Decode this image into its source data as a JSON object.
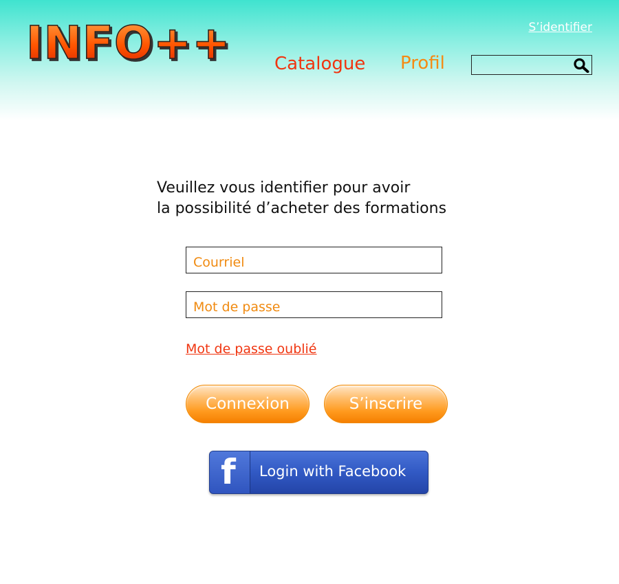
{
  "header": {
    "logo_text": "INFO++",
    "signin_link": "S’identifier",
    "nav": {
      "catalogue": "Catalogue",
      "profil": "Profil"
    },
    "search": {
      "placeholder": "",
      "icon": "search-icon"
    }
  },
  "login": {
    "intro_line1": "Veuillez vous identifier pour avoir",
    "intro_line2": "la possibilité d’acheter des formations",
    "email_placeholder": "Courriel",
    "password_placeholder": "Mot de passe",
    "forgot_link": "Mot de passe oublié",
    "connexion_label": "Connexion",
    "inscrire_label": "S’inscrire",
    "facebook_label": "Login with Facebook",
    "facebook_icon_letter": "f"
  },
  "colors": {
    "header_gradient_top": "#3fe3cf",
    "nav_catalogue": "#f03510",
    "nav_profil": "#f58a12",
    "field_text": "#f08a10",
    "button_orange": "#ff9a1e",
    "facebook_blue": "#3159c4"
  }
}
